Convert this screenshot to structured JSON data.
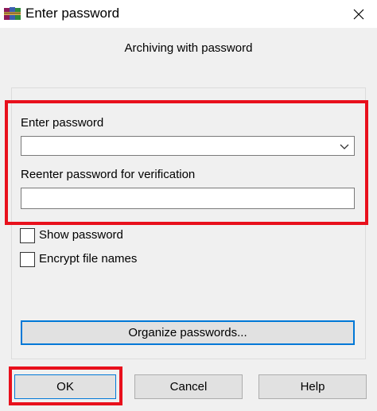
{
  "window": {
    "title": "Enter password",
    "app_icon": "winrar-books-icon",
    "close_icon": "close-icon"
  },
  "dialog": {
    "subtitle": "Archiving with password",
    "enter_password_label": "Enter password",
    "password_value": "",
    "reenter_label": "Reenter password for verification",
    "reenter_value": "",
    "show_password_label": "Show password",
    "show_password_checked": false,
    "encrypt_names_label": "Encrypt file names",
    "encrypt_names_checked": false,
    "organize_label": "Organize passwords...",
    "ok_label": "OK",
    "cancel_label": "Cancel",
    "help_label": "Help"
  },
  "colors": {
    "highlight": "#e8101c",
    "accent": "#0078d7"
  }
}
